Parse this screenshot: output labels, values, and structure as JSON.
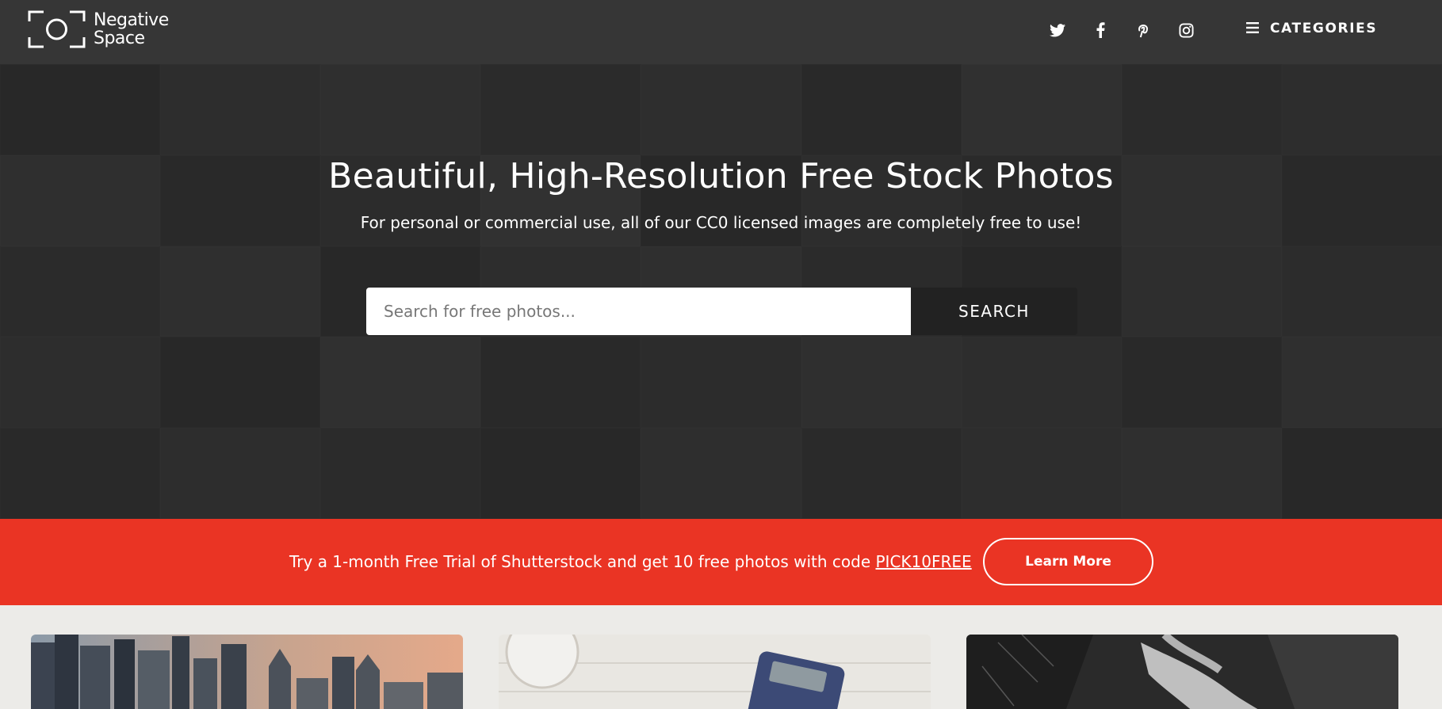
{
  "header": {
    "logo_line1": "Negative",
    "logo_line2": "Space",
    "social": [
      "twitter-icon",
      "facebook-icon",
      "pinterest-icon",
      "instagram-icon"
    ],
    "categories_label": "CATEGORIES"
  },
  "hero": {
    "title": "Beautiful, High-Resolution Free Stock Photos",
    "subtitle": "For personal or commercial use, all of our CC0 licensed images are completely free to use!",
    "search_placeholder": "Search for free photos...",
    "search_button": "SEARCH"
  },
  "promo": {
    "text": "Try a 1-month Free Trial of Shutterstock and get 10 free photos with code ",
    "code": "PICK10FREE",
    "button": "Learn More",
    "color": "#ea3424"
  },
  "gallery": {
    "photos": [
      "city-skyline-photo",
      "desk-calculator-photo",
      "waterfall-photo"
    ]
  }
}
